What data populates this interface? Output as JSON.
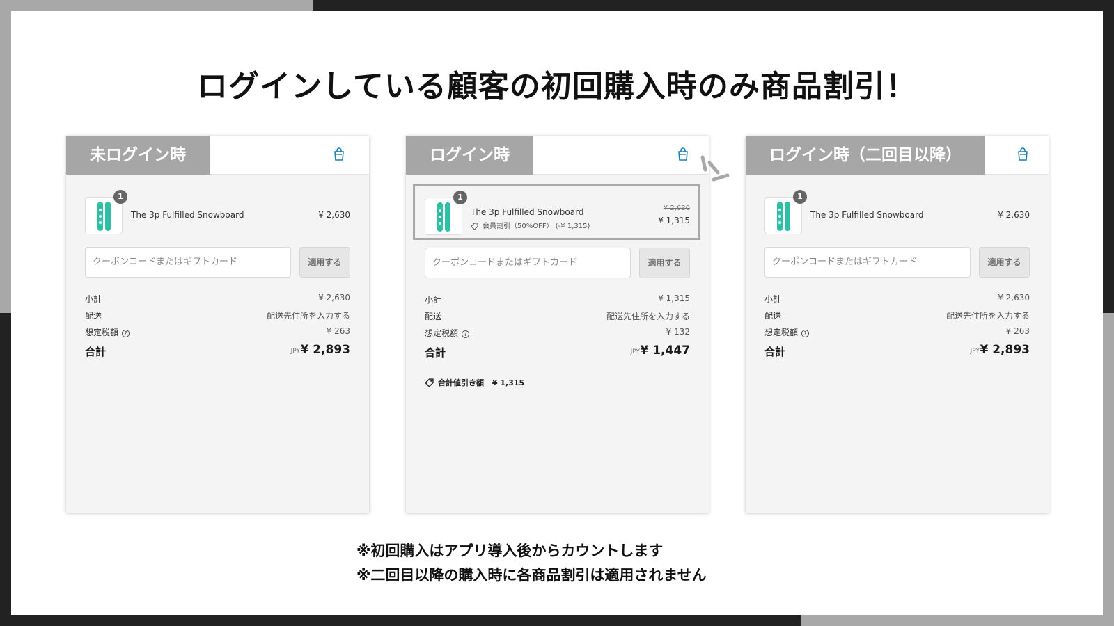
{
  "headline": "ログインしている顧客の初回購入時のみ商品割引！",
  "product_name": "The 3p Fulfilled Snowboard",
  "quantity": "1",
  "coupon_placeholder": "クーポンコードまたはギフトカード",
  "apply_label": "適用する",
  "labels": {
    "subtotal": "小計",
    "shipping": "配送",
    "tax": "想定税額",
    "total": "合計",
    "currency": "JPY"
  },
  "shipping_value": "配送先住所を入力する",
  "panels": [
    {
      "tab": "未ログイン時",
      "price": "¥ 2,630",
      "subtotal": "¥ 2,630",
      "tax": "¥ 263",
      "total": "¥ 2,893"
    },
    {
      "tab": "ログイン時",
      "original_price": "¥ 2,630",
      "price": "¥ 1,315",
      "discount_label": "会員割引（50%OFF） (-¥ 1,315)",
      "subtotal": "¥ 1,315",
      "tax": "¥ 132",
      "total": "¥ 1,447",
      "total_savings_label": "合計値引き額",
      "total_savings_value": "¥ 1,315"
    },
    {
      "tab": "ログイン時（二回目以降）",
      "price": "¥ 2,630",
      "subtotal": "¥ 2,630",
      "tax": "¥ 263",
      "total": "¥ 2,893"
    }
  ],
  "notes": [
    "※初回購入はアプリ導入後からカウントします",
    "※二回目以降の購入時に各商品割引は適用されません"
  ],
  "colors": {
    "accent": "#1a7fb5",
    "tab_gray": "#a6a6a6",
    "frame_dark": "#222222",
    "frame_gray": "#a8a8a8",
    "snowboard": "#2ebfa5"
  },
  "icons": [
    "shopping-bag-icon",
    "help-circle-icon",
    "tag-icon",
    "spark-icon"
  ]
}
